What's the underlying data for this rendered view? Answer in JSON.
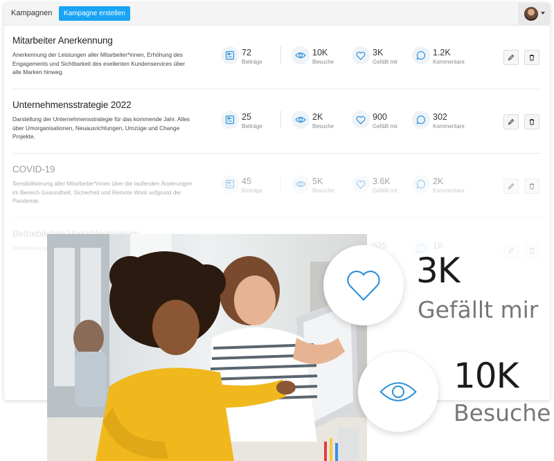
{
  "header": {
    "title": "Kampagnen",
    "create_button": "Kampagne erstellen"
  },
  "campaigns": [
    {
      "title": "Mitarbeiter Anerkennung",
      "description": "Anerkennung der Leistungen aller Mitarbeiter*innen, Erhöhung des Engagements und Sichtbarkeit des exellenten Kundenservices über alle Marken hinweg.",
      "posts": "72",
      "posts_label": "Beiträge",
      "views": "10K",
      "views_label": "Besuche",
      "likes": "3K",
      "likes_label": "Gefällt mir",
      "comments": "1.2K",
      "comments_label": "Kommentare"
    },
    {
      "title": "Unternehmensstrategie 2022",
      "description": "Darstellung der Unternehmensstrategie für das kommende Jahr. Alles über Umorganisationen, Neuausrichtungen, Umzüge und Change Projekte.",
      "posts": "25",
      "posts_label": "Beiträge",
      "views": "2K",
      "views_label": "Besuche",
      "likes": "900",
      "likes_label": "Gefällt mir",
      "comments": "302",
      "comments_label": "Kommentare"
    },
    {
      "title": "COVID-19",
      "description": "Sensibilisierung aller Mitarbeiter*innen über die laufenden Änderungen im Bereich Gesundheit, Sicherheit und Remote Work aufgrund der Pandemie.",
      "posts": "45",
      "posts_label": "Beiträge",
      "views": "5K",
      "views_label": "Besuche",
      "likes": "3.6K",
      "likes_label": "Gefällt mir",
      "comments": "2K",
      "comments_label": "Kommentare"
    },
    {
      "title": "Betriebliches Vorschlagswesen",
      "description": "Verbesserungsvorschläge durch Mitarbeiter*innen",
      "posts": "",
      "posts_label": "",
      "views": "",
      "views_label": "",
      "likes": "625",
      "likes_label": "",
      "comments": "1K",
      "comments_label": ""
    }
  ],
  "highlights": {
    "likes_value": "3K",
    "likes_label": "Gefällt mir",
    "views_value": "10K",
    "views_label": "Besuche"
  },
  "colors": {
    "accent": "#1aa4f5",
    "icon_blue": "#2b8fd8"
  }
}
